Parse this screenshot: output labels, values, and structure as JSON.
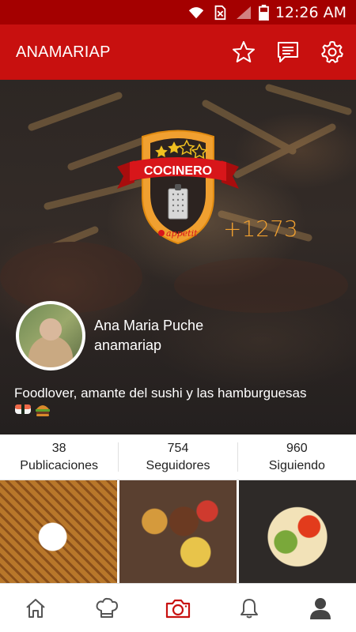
{
  "status_bar": {
    "time": "12:26 AM",
    "icons": [
      "wifi-icon",
      "no-sim-icon",
      "signal-icon",
      "battery-icon"
    ]
  },
  "app_bar": {
    "title": "ANAMARIAP",
    "actions": [
      "star-icon",
      "message-icon",
      "gear-icon"
    ]
  },
  "badge": {
    "rank": "COCINERO",
    "stars_filled": 2,
    "stars_total": 4,
    "brand": "appetit",
    "icon": "grater-icon"
  },
  "profile": {
    "points": "+1273",
    "name": "Ana Maria Puche",
    "username": "anamariap",
    "bio": "Foodlover, amante del sushi y las hamburguesas",
    "bio_emojis": [
      "sushi-icon",
      "burger-icon"
    ]
  },
  "stats": [
    {
      "value": "38",
      "label": "Publicaciones"
    },
    {
      "value": "754",
      "label": "Seguidores"
    },
    {
      "value": "960",
      "label": "Siguiendo"
    }
  ],
  "photos": [
    "waffle-photo",
    "platter-photo",
    "nachos-photo"
  ],
  "bottom_nav": [
    "home-icon",
    "chef-hat-icon",
    "camera-icon",
    "bell-icon",
    "profile-icon"
  ],
  "colors": {
    "app_bar": "#c8100f",
    "status_bar": "#a40000",
    "accent": "#f0a030",
    "camera_active": "#c8100f"
  }
}
